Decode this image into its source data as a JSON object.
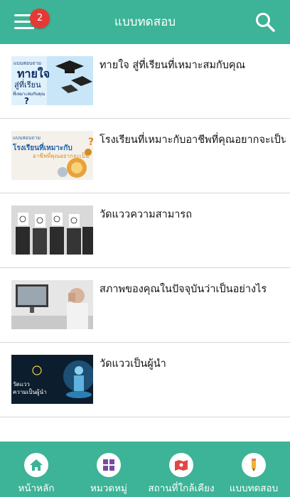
{
  "header": {
    "title": "แบบทดสอบ",
    "badge_count": "2",
    "menu_icon": "hamburger-menu-icon",
    "search_icon": "search-icon"
  },
  "colors": {
    "primary": "#3db397",
    "badge": "#e53935"
  },
  "list": {
    "items": [
      {
        "title": "ทายใจ  สู่ที่เรียนที่เหมาะสมกับคุณ",
        "thumb_lines": [
          "แบบสอบถาม",
          "ทายใจ",
          "สู่ที่เรียน",
          "ที่เหมาะสมกับคุณ"
        ]
      },
      {
        "title": "โรงเรียนที่เหมาะกับอาชีพที่คุณอยากจะเป็น",
        "thumb_lines": [
          "แบบสอบถาม",
          "โรงเรียนที่เหมาะกับ",
          "อาชีพที่คุณอยากจะเป็น"
        ]
      },
      {
        "title": "วัดแววความสามารถ",
        "thumb_lines": []
      },
      {
        "title": "สภาพของคุณในปัจจุบันว่าเป็นอย่างไร",
        "thumb_lines": []
      },
      {
        "title": "วัดแววเป็นผู้นำ",
        "thumb_lines": [
          "วัดแวว",
          "ความเป็นผู้นำ"
        ]
      }
    ]
  },
  "bottom_nav": {
    "items": [
      {
        "label": "หน้าหลัก",
        "icon": "home-icon"
      },
      {
        "label": "หมวดหมู่",
        "icon": "category-grid-icon"
      },
      {
        "label": "สถานที่ใกล้เคียง",
        "icon": "map-icon"
      },
      {
        "label": "แบบทดสอบ",
        "icon": "quiz-pencil-icon"
      }
    ]
  }
}
